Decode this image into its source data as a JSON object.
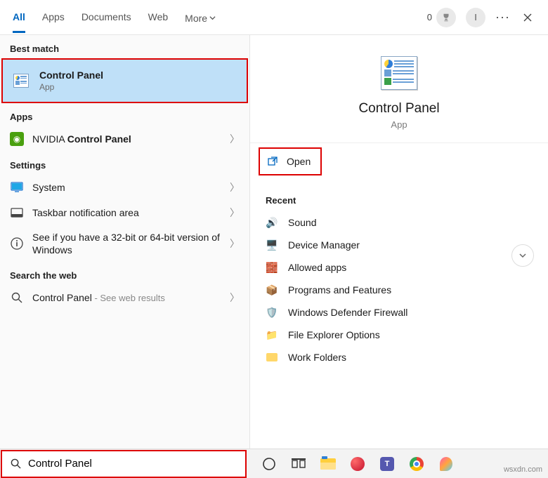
{
  "header": {
    "tabs": [
      {
        "label": "All",
        "active": true
      },
      {
        "label": "Apps"
      },
      {
        "label": "Documents"
      },
      {
        "label": "Web"
      },
      {
        "label": "More"
      }
    ],
    "points": "0",
    "avatar_initial": "I"
  },
  "left": {
    "best_match_label": "Best match",
    "best_match": {
      "title": "Control Panel",
      "subtitle": "App"
    },
    "apps_label": "Apps",
    "apps": [
      {
        "prefix": "NVIDIA ",
        "bold": "Control Panel"
      }
    ],
    "settings_label": "Settings",
    "settings": [
      {
        "title": "System"
      },
      {
        "title": "Taskbar notification area"
      },
      {
        "title": "See if you have a 32-bit or 64-bit version of Windows"
      }
    ],
    "web_label": "Search the web",
    "web": {
      "title": "Control Panel",
      "hint": " - See web results"
    }
  },
  "preview": {
    "title": "Control Panel",
    "subtitle": "App",
    "open_label": "Open",
    "recent_label": "Recent",
    "recent": [
      {
        "label": "Sound"
      },
      {
        "label": "Device Manager"
      },
      {
        "label": "Allowed apps"
      },
      {
        "label": "Programs and Features"
      },
      {
        "label": "Windows Defender Firewall"
      },
      {
        "label": "File Explorer Options"
      },
      {
        "label": "Work Folders"
      }
    ]
  },
  "search": {
    "value": "Control Panel"
  },
  "watermark": "wsxdn.com"
}
